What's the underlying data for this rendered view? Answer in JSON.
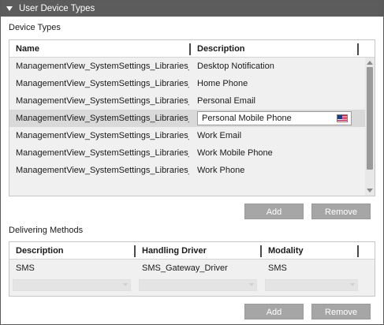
{
  "window": {
    "title": "User Device Types"
  },
  "device_types": {
    "section_label": "Device Types",
    "columns": [
      "Name",
      "Description"
    ],
    "rows": [
      {
        "name": "ManagementView_SystemSettings_Libraries_",
        "description": "Desktop Notification"
      },
      {
        "name": "ManagementView_SystemSettings_Libraries_",
        "description": "Home Phone"
      },
      {
        "name": "ManagementView_SystemSettings_Libraries_",
        "description": "Personal Email"
      },
      {
        "name": "ManagementView_SystemSettings_Libraries_",
        "description": "Personal Mobile Phone",
        "selected": true,
        "editing": true,
        "flag_icon": "us-flag-icon"
      },
      {
        "name": "ManagementView_SystemSettings_Libraries_",
        "description": "Work Email"
      },
      {
        "name": "ManagementView_SystemSettings_Libraries_",
        "description": "Work Mobile Phone"
      },
      {
        "name": "ManagementView_SystemSettings_Libraries_",
        "description": "Work Phone"
      }
    ],
    "add_label": "Add",
    "remove_label": "Remove"
  },
  "delivering_methods": {
    "section_label": "Delivering Methods",
    "columns": [
      "Description",
      "Handling Driver",
      "Modality"
    ],
    "rows": [
      {
        "description": "SMS",
        "handling_driver": "SMS_Gateway_Driver",
        "modality": "SMS"
      }
    ],
    "add_label": "Add",
    "remove_label": "Remove"
  },
  "colors": {
    "titlebar": "#5c5c5c",
    "selected_row": "#d9d9d9",
    "button": "#a6a6a6",
    "panel": "#f0f0f0"
  }
}
